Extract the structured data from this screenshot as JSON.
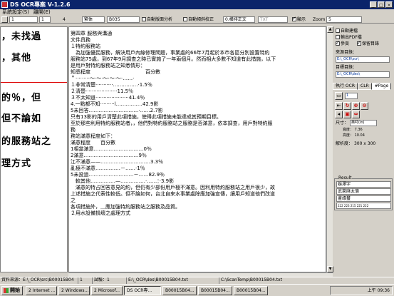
{
  "window": {
    "title": "DS OCR專案 V-1.2.6",
    "controls": [
      "_",
      "□",
      "×"
    ]
  },
  "menu": [
    "系統設定(S)",
    "離開(E)"
  ],
  "toolbar": {
    "page_field": "1",
    "page_value": "1",
    "page_number": "4",
    "font_select": "繁体",
    "encoding_select": "B035",
    "auto_layout_label": "自動版面分析",
    "auto_layout_checked": false,
    "auto_correct_label": "自動傾斜校正",
    "auto_correct_checked": false,
    "direction_select": "0.橫排正文",
    "format_select": "TXT",
    "display_label": "顯示",
    "display_checked": true,
    "zoom_label": "Zoom",
    "zoom_value": "5"
  },
  "image_pane": {
    "lines": [
      "，未找過",
      "，其他",
      "的％，但",
      "但不論如",
      "的服務站之",
      "理方式"
    ],
    "tags": [
      "無",
      "半"
    ]
  },
  "text_pane": {
    "lines": [
      "第四章 服務與溝通",
      "文件具務",
      "１特約服務站",
      "　為加強優民服務，解決用戶內線修理問題，事業處的66年7月起於本市各區分別設置特約",
      "服務站75處，到67年9月調查之時已實施了一年兩個月。然而相大多數不知道有此措施，以下",
      "是用戶對特約服務站之知悉情形：",
      "知悉程度　　　　　　　　　　　百分數",
      "＂·········～·～·～·～·～·……·",
      "１非常清楚···········……………·1.5％",
      "２清楚····················11.5％",
      "３不太知道·····················41.4％",
      "4.一點都不知·········l.……………42.9影",
      "5未回答…………………………·……2.7影",
      "只有13影的用戶清楚此項措施，使得此項措施未能達成其預期目標。",
      "至於那些利用特約服務站者，，他們對特約服務站之服務是否滿意，依本調查，用戶對特約服",
      "務",
      "務站滿意程度如下：",
      "滿意程度　　百分數",
      "1相當滿意…………………………0％",
      "2滿意……………………………9％",
      "江不滿意——…………………………3.3％",
      "亂極不滿意……………－……·1％",
      "5未投過………………………－……82.9％",
      "　較其他……………—……………·……：·3.9影",
      "　滿意的特占回答意見的約，但仍有少部份用戶極不滿意。因利用特約服務站之用戶很少，故",
      "上述措施之代表性較低。但不論如何，台北自來水事業處除應加強宣傳，讓用戶知道他們改道",
      "之",
      "各項措施外，＿應加強特約服務站之服務及品質。",
      "２用水設備損壞之處理方式"
    ]
  },
  "right_panel": {
    "auto_directory_label": "自動建檔",
    "auto_directory_checked": false,
    "output_pdf_label": "輸出PDF檔",
    "output_pdf_checked": false,
    "single_page_label": "參頁",
    "single_page_checked": true,
    "keep_dir_label": "保留目錄",
    "keep_dir_checked": true,
    "source_dir_label": "來源目錄：",
    "source_dir_value": "E:\\_OCR\\scr\\",
    "target_dir_label": "目標目錄：",
    "target_dir_value": "E:\\_OCR\\des\\",
    "tabs": [
      "執行 OCR",
      "CLR",
      "#Page"
    ],
    "active_tab": "#Page",
    "page_field": "1",
    "size_label": "尺寸：",
    "size_select": "英吋(in)",
    "width_label": "寬度：",
    "width_value": "7.36",
    "height_label": "高度：",
    "height_value": "10.04",
    "resolution_label": "解析度：",
    "resolution_value": "300 x 300",
    "result_title": "Result",
    "result_lines": [
      "娛澤字",
      "武萊麻太蒗",
      "畫缘璽",
      "222 223 215 221 222"
    ]
  },
  "statusbar": {
    "source_label": "資料來源：",
    "source_value": "E:\\_OCR\\src\\B00015B04",
    "page_value": "1",
    "count_label": "試驗：",
    "count_value": "1",
    "output_path": "E:\\_OCR\\des\\B00015B04.txt",
    "temp_path": "C:\\ScanTemp\\B00015B04.txt"
  },
  "taskbar": {
    "start_label": "開始",
    "tasks": [
      "2 Internet ...",
      "2 Windows...",
      "2 Microsof...",
      "DS OCR專...",
      "B00015B04...",
      "B00015B04...",
      "B00015B04..."
    ],
    "active_task": 3,
    "clock": "上午 09:36"
  }
}
